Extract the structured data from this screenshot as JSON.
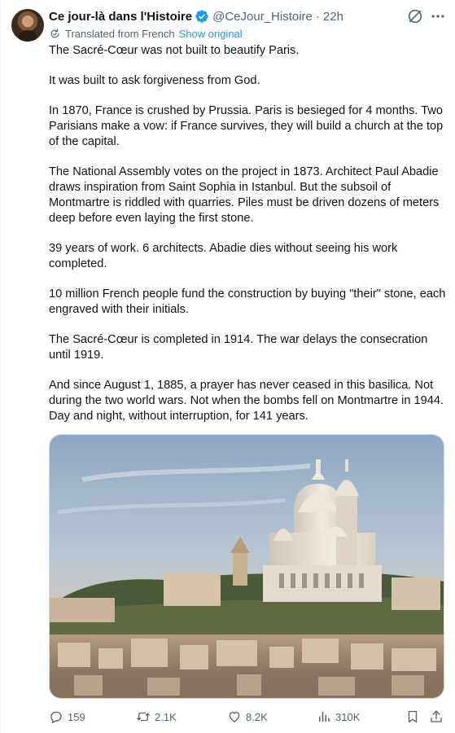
{
  "post": {
    "author_name": "Ce jour-là dans l'Histoire",
    "handle": "@CeJour_Histoire",
    "separator": "·",
    "time": "22h",
    "translated_label": "Translated from French",
    "show_original": "Show original",
    "paragraphs": [
      "The Sacré-Cœur was not built to beautify Paris.",
      "It was built to ask forgiveness from God.",
      "In 1870, France is crushed by Prussia. Paris is besieged for 4 months. Two Parisians make a vow: if France survives, they will build a church at the top of the capital.",
      "The National Assembly votes on the project in 1873. Architect Paul Abadie draws inspiration from Saint Sophia in Istanbul. But the subsoil of Montmartre is riddled with quarries. Piles must be driven dozens of meters deep before even laying the first stone.",
      "39 years of work. 6 architects. Abadie dies without seeing his work completed.",
      "10 million French people fund the construction by buying \"their\" stone, each engraved with their initials.",
      "The Sacré-Cœur is completed in 1914. The war delays the consecration until 1919.",
      "And since August 1, 1885, a prayer has never ceased in this basilica. Not during the two world wars. Not when the bombs fell on Montmartre in 1944. Day and night, without interruption, for 141 years."
    ],
    "image_icon": "sacre-coeur-photo",
    "stats": {
      "replies": "159",
      "reposts": "2.1K",
      "likes": "8.2K",
      "views": "310K"
    }
  },
  "icons": {
    "verified": "verified-badge-icon",
    "grok": "grok-icon",
    "more": "more-icon",
    "translate": "translate-icon",
    "reply": "reply-icon",
    "repost": "repost-icon",
    "like": "heart-icon",
    "views": "views-icon",
    "bookmark": "bookmark-icon",
    "share": "share-icon"
  },
  "colors": {
    "text": "#0f1419",
    "secondary": "#536471",
    "accent": "#1d9bf0",
    "border": "#cfd9de"
  }
}
